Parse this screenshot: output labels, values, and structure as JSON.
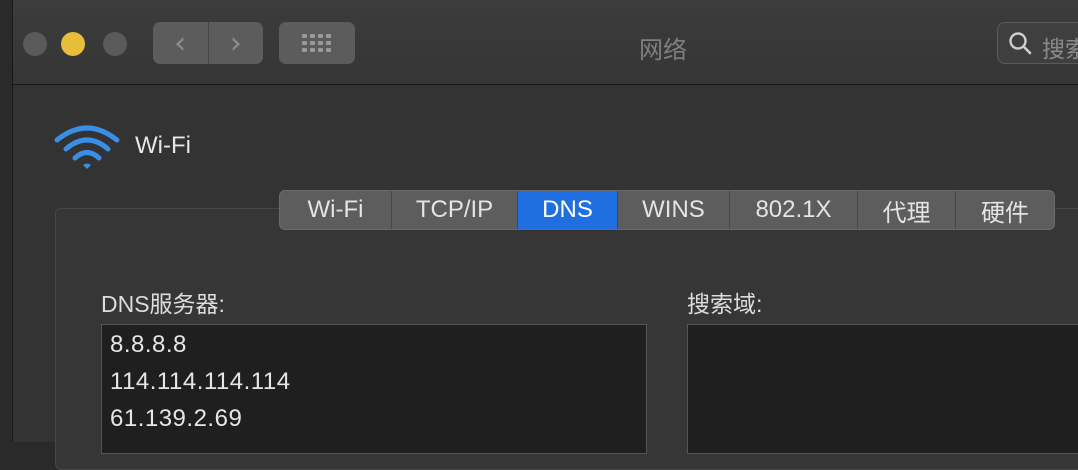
{
  "window": {
    "title": "网络"
  },
  "toolbar": {
    "back_glyph": "‹",
    "forward_glyph": "›",
    "search_placeholder": "搜索"
  },
  "interface": {
    "name": "Wi-Fi",
    "icon": "wifi-icon"
  },
  "tabs": [
    {
      "label": "Wi-Fi",
      "active": false
    },
    {
      "label": "TCP/IP",
      "active": false
    },
    {
      "label": "DNS",
      "active": true
    },
    {
      "label": "WINS",
      "active": false
    },
    {
      "label": "802.1X",
      "active": false
    },
    {
      "label": "代理",
      "active": false
    },
    {
      "label": "硬件",
      "active": false
    }
  ],
  "dns": {
    "label": "DNS服务器:",
    "servers": [
      "8.8.8.8",
      "114.114.114.114",
      "61.139.2.69"
    ]
  },
  "search_domains": {
    "label": "搜索域:"
  },
  "colors": {
    "accent": "#1f6fe0",
    "wifi_icon": "#3a8ee6",
    "minimize": "#e6be3a"
  }
}
